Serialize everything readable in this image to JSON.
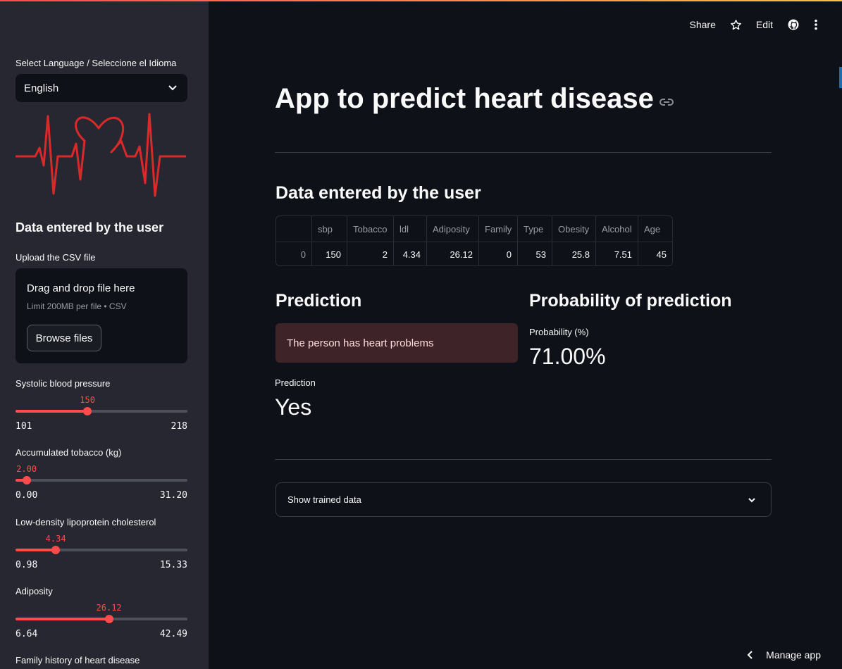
{
  "header": {
    "share_label": "Share",
    "edit_label": "Edit",
    "star_icon": "star-icon",
    "github_icon": "github-icon",
    "menu_icon": "kebab-menu-icon"
  },
  "sidebar": {
    "language_label": "Select Language / Seleccione el Idioma",
    "language_value": "English",
    "section_title": "Data entered by the user",
    "upload_label": "Upload the CSV file",
    "dropzone_title": "Drag and drop file here",
    "dropzone_limit": "Limit 200MB per file • CSV",
    "browse_label": "Browse files",
    "sliders": [
      {
        "label": "Systolic blood pressure",
        "value": "150",
        "min": "101",
        "max": "218",
        "fraction": 0.4188
      },
      {
        "label": "Accumulated tobacco (kg)",
        "value": "2.00",
        "min": "0.00",
        "max": "31.20",
        "fraction": 0.0641
      },
      {
        "label": "Low-density lipoprotein cholesterol",
        "value": "4.34",
        "min": "0.98",
        "max": "15.33",
        "fraction": 0.2341
      },
      {
        "label": "Adiposity",
        "value": "26.12",
        "min": "6.64",
        "max": "42.49",
        "fraction": 0.5434
      }
    ],
    "family_label": "Family history of heart disease"
  },
  "main": {
    "title": "App to predict heart disease",
    "data_title": "Data entered by the user",
    "table": {
      "columns": [
        "",
        "sbp",
        "Tobacco",
        "ldl",
        "Adiposity",
        "Family",
        "Type",
        "Obesity",
        "Alcohol",
        "Age"
      ],
      "rows": [
        [
          "0",
          "150",
          "2",
          "4.34",
          "26.12",
          "0",
          "53",
          "25.8",
          "7.51",
          "45"
        ]
      ]
    },
    "prediction_title": "Prediction",
    "alert_text": "The person has heart problems",
    "prediction_metric_label": "Prediction",
    "prediction_metric_value": "Yes",
    "probability_title": "Probability of prediction",
    "probability_metric_label": "Probability (%)",
    "probability_metric_value": "71.00%",
    "expander_label": "Show trained data"
  },
  "footer": {
    "manage_label": "Manage app"
  },
  "colors": {
    "accent": "#ff4b4b",
    "background": "#0e1117",
    "sidebar": "#262730",
    "alert_bg": "#3e2428"
  }
}
